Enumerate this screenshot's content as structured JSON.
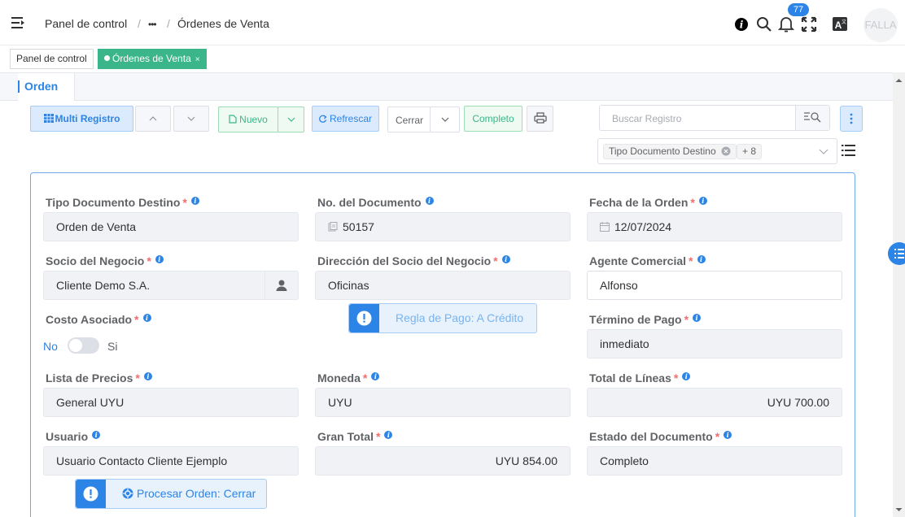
{
  "header": {
    "breadcrumb": {
      "home": "Panel de control",
      "separator": "/",
      "ellipsis": "•••",
      "current": "Órdenes de Venta"
    },
    "icons": [
      "hamburger-icon",
      "info-icon",
      "search-icon",
      "bell-icon",
      "fullscreen-icon",
      "translate-icon"
    ],
    "notification_count": "77",
    "avatar_text": "FALLA"
  },
  "tags": {
    "home": "Panel de control",
    "active": "Órdenes de Venta",
    "close": "×"
  },
  "tab": {
    "label": "Orden"
  },
  "toolbar": {
    "multi_registro": "Multi Registro",
    "nuevo": "Nuevo",
    "refrescar": "Refrescar",
    "cerrar": "Cerrar",
    "completo": "Completo",
    "search_placeholder": "Buscar Registro"
  },
  "filter": {
    "chip": "Tipo Documento Destino",
    "more": "+ 8"
  },
  "form": {
    "tipo_documento": {
      "label": "Tipo Documento Destino",
      "value": "Orden de Venta"
    },
    "no_documento": {
      "label": "No. del Documento",
      "value": "50157"
    },
    "fecha_orden": {
      "label": "Fecha de la Orden",
      "value": "12/07/2024"
    },
    "socio_negocio": {
      "label": "Socio del Negocio",
      "value": "Cliente Demo S.A."
    },
    "direccion_socio": {
      "label": "Dirección del Socio del Negocio",
      "value": "Oficinas"
    },
    "agente_comercial": {
      "label": "Agente Comercial",
      "value": "Alfonso"
    },
    "costo_asociado": {
      "label": "Costo Asociado",
      "off": "No",
      "on": "Si"
    },
    "regla_pago": "Regla de Pago: A Crédito",
    "termino_pago": {
      "label": "Término de Pago",
      "value": "inmediato"
    },
    "lista_precios": {
      "label": "Lista de Precios",
      "value": "General UYU"
    },
    "moneda": {
      "label": "Moneda",
      "value": "UYU"
    },
    "total_lineas": {
      "label": "Total de Líneas",
      "value": "UYU 700.00"
    },
    "usuario": {
      "label": "Usuario",
      "value": "Usuario Contacto Cliente Ejemplo"
    },
    "gran_total": {
      "label": "Gran Total",
      "value": "UYU 854.00"
    },
    "estado_documento": {
      "label": "Estado del Documento",
      "value": "Completo"
    },
    "procesar_orden": "Procesar Orden: Cerrar"
  },
  "colors": {
    "accent": "#2c84e6",
    "success": "#3bb58a",
    "required": "#f56c6c"
  }
}
